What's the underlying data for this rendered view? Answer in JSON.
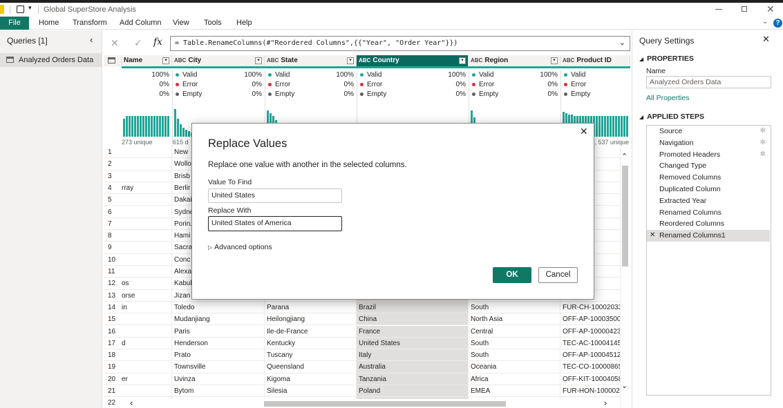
{
  "app": {
    "title": "Global SuperStore Analysis"
  },
  "menu": {
    "file": "File",
    "items": [
      "Home",
      "Transform",
      "Add Column",
      "View",
      "Tools",
      "Help"
    ]
  },
  "queries": {
    "header": "Queries [1]",
    "items": [
      {
        "label": "Analyzed Orders Data"
      }
    ]
  },
  "formula": {
    "text": "= Table.RenameColumns(#\"Reordered Columns\",{{\"Year\", \"Order Year\"}})"
  },
  "columns": [
    {
      "name": "Name",
      "type_icon": "ABC"
    },
    {
      "name": "City",
      "type_icon": "ABC"
    },
    {
      "name": "State",
      "type_icon": "ABC"
    },
    {
      "name": "Country",
      "type_icon": "ABC"
    },
    {
      "name": "Region",
      "type_icon": "ABC"
    },
    {
      "name": "Product ID",
      "type_icon": "ABC"
    }
  ],
  "profile": {
    "labels": [
      "Valid",
      "Error",
      "Empty"
    ],
    "pcts": [
      "100%",
      "0%",
      "0%"
    ],
    "colors": {
      "valid": "#21a597",
      "error": "#d13438",
      "empty": "#605e5c"
    },
    "name_unique": "273 unique",
    "city_unique": "615 d",
    "product_unique": "ct, 537 unique"
  },
  "rows": [
    {
      "n": "1",
      "name": "",
      "city": "New",
      "state": "",
      "country": "",
      "region": "",
      "pid": "003033"
    },
    {
      "n": "2",
      "name": "",
      "city": "Wollo",
      "state": "",
      "country": "",
      "region": "",
      "pid": "003950"
    },
    {
      "n": "3",
      "name": "",
      "city": "Brisb",
      "state": "",
      "country": "",
      "region": "",
      "pid": "004664"
    },
    {
      "n": "4",
      "name": "rray",
      "city": "Berlir",
      "state": "",
      "country": "",
      "region": "",
      "pid": "004583"
    },
    {
      "n": "5",
      "name": "",
      "city": "Dakai",
      "state": "",
      "country": "",
      "region": "",
      "pid": "0000501"
    },
    {
      "n": "6",
      "name": "",
      "city": "Sydne",
      "state": "",
      "country": "",
      "region": "",
      "pid": "000030"
    },
    {
      "n": "7",
      "name": "",
      "city": "Poriru",
      "state": "",
      "country": "",
      "region": "",
      "pid": "004050"
    },
    {
      "n": "8",
      "name": "",
      "city": "Hami",
      "state": "",
      "country": "",
      "region": "",
      "pid": "002958"
    },
    {
      "n": "9",
      "name": "",
      "city": "Sacra",
      "state": "",
      "country": "",
      "region": "",
      "pid": "03527"
    },
    {
      "n": "10",
      "name": "",
      "city": "Conc",
      "state": "",
      "country": "",
      "region": "",
      "pid": "000198"
    },
    {
      "n": "11",
      "name": "",
      "city": "Alexa",
      "state": "",
      "country": "",
      "region": "",
      "pid": "002881"
    },
    {
      "n": "12",
      "name": "os",
      "city": "Kabul",
      "state": "",
      "country": "",
      "region": "",
      "pid": "001889"
    },
    {
      "n": "13",
      "name": "orse",
      "city": "Jizan",
      "state": "",
      "country": "",
      "region": "",
      "pid": "001717"
    },
    {
      "n": "14",
      "name": "in",
      "city": "Toledo",
      "state": "Parana",
      "country": "Brazil",
      "region": "South",
      "pid": "FUR-CH-10002033"
    },
    {
      "n": "15",
      "name": "",
      "city": "Mudanjiang",
      "state": "Heilongjiang",
      "country": "China",
      "region": "North Asia",
      "pid": "OFF-AP-10003500"
    },
    {
      "n": "16",
      "name": "",
      "city": "Paris",
      "state": "Ile-de-France",
      "country": "France",
      "region": "Central",
      "pid": "OFF-AP-10000423"
    },
    {
      "n": "17",
      "name": "d",
      "city": "Henderson",
      "state": "Kentucky",
      "country": "United States",
      "region": "South",
      "pid": "TEC-AC-10004145"
    },
    {
      "n": "18",
      "name": "",
      "city": "Prato",
      "state": "Tuscany",
      "country": "Italy",
      "region": "South",
      "pid": "OFF-AP-10004512"
    },
    {
      "n": "19",
      "name": "",
      "city": "Townsville",
      "state": "Queensland",
      "country": "Australia",
      "region": "Oceania",
      "pid": "TEC-CO-10000865"
    },
    {
      "n": "20",
      "name": "er",
      "city": "Uvinza",
      "state": "Kigoma",
      "country": "Tanzania",
      "region": "Africa",
      "pid": "OFF-KIT-10004058"
    },
    {
      "n": "21",
      "name": "",
      "city": "Bytom",
      "state": "Silesia",
      "country": "Poland",
      "region": "EMEA",
      "pid": "FUR-HON-10000224"
    },
    {
      "n": "22",
      "name": "",
      "city": "",
      "state": "",
      "country": "",
      "region": "",
      "pid": ""
    }
  ],
  "dialog": {
    "title": "Replace Values",
    "description": "Replace one value with another in the selected columns.",
    "find_label": "Value To Find",
    "find_value": "United States",
    "replace_label": "Replace With",
    "replace_value": "United States of America",
    "advanced": "Advanced options",
    "ok": "OK",
    "cancel": "Cancel"
  },
  "settings": {
    "title": "Query Settings",
    "properties_header": "PROPERTIES",
    "name_label": "Name",
    "name_value": "Analyzed Orders Data",
    "all_properties": "All Properties",
    "steps_header": "APPLIED STEPS",
    "steps": [
      {
        "label": "Source",
        "gear": true
      },
      {
        "label": "Navigation",
        "gear": true
      },
      {
        "label": "Promoted Headers",
        "gear": true
      },
      {
        "label": "Changed Type",
        "gear": false
      },
      {
        "label": "Removed Columns",
        "gear": false
      },
      {
        "label": "Duplicated Column",
        "gear": false
      },
      {
        "label": "Extracted Year",
        "gear": false
      },
      {
        "label": "Renamed Columns",
        "gear": false
      },
      {
        "label": "Reordered Columns",
        "gear": false
      },
      {
        "label": "Renamed Columns1",
        "gear": false
      }
    ]
  },
  "colors": {
    "accent": "#117865",
    "teal": "#21a597",
    "selected_header": "#0b6a60"
  }
}
